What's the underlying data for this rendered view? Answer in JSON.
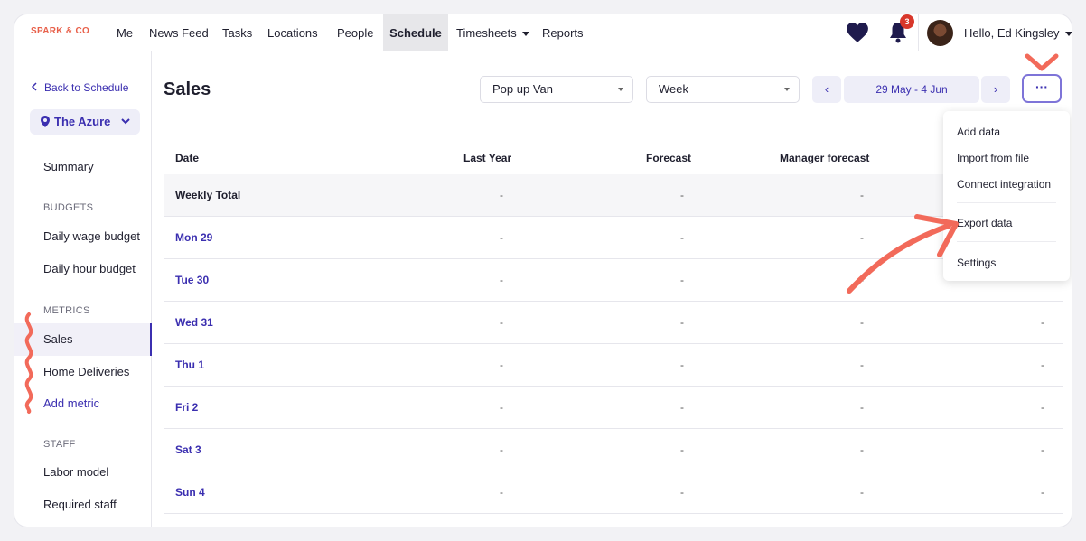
{
  "brand": "SPARK & CO",
  "nav": {
    "items": [
      "Me",
      "News Feed",
      "Tasks",
      "Locations",
      "People",
      "Schedule",
      "Timesheets",
      "Reports"
    ],
    "active": "Schedule",
    "notification_count": "3",
    "greeting": "Hello, Ed Kingsley"
  },
  "sidebar": {
    "back_label": "Back to Schedule",
    "location": "The Azure",
    "summary": "Summary",
    "budgets_heading": "BUDGETS",
    "daily_wage_budget": "Daily wage budget",
    "daily_hour_budget": "Daily hour budget",
    "metrics_heading": "METRICS",
    "sales": "Sales",
    "home_deliveries": "Home Deliveries",
    "add_metric": "Add metric",
    "staff_heading": "STAFF",
    "labor_model": "Labor model",
    "required_staff": "Required staff"
  },
  "main": {
    "title": "Sales",
    "location_select": "Pop up Van",
    "period_select": "Week",
    "prev": "‹",
    "next": "›",
    "date_range": "29 May - 4 Jun",
    "more": "···"
  },
  "table": {
    "headers": [
      "Date",
      "Last Year",
      "Forecast",
      "Manager forecast"
    ],
    "rows": [
      {
        "date": "Weekly Total",
        "cells": [
          "-",
          "-",
          "-"
        ]
      },
      {
        "date": "Mon 29",
        "cells": [
          "-",
          "-",
          "-"
        ]
      },
      {
        "date": "Tue 30",
        "cells": [
          "-",
          "-",
          "-"
        ]
      },
      {
        "date": "Wed 31",
        "cells": [
          "-",
          "-",
          "-",
          "-"
        ]
      },
      {
        "date": "Thu 1",
        "cells": [
          "-",
          "-",
          "-",
          "-"
        ]
      },
      {
        "date": "Fri 2",
        "cells": [
          "-",
          "-",
          "-",
          "-"
        ]
      },
      {
        "date": "Sat 3",
        "cells": [
          "-",
          "-",
          "-",
          "-"
        ]
      },
      {
        "date": "Sun 4",
        "cells": [
          "-",
          "-",
          "-",
          "-"
        ]
      }
    ]
  },
  "menu": {
    "add_data": "Add data",
    "import_from_file": "Import from file",
    "connect_integration": "Connect integration",
    "export_data": "Export data",
    "settings": "Settings"
  },
  "colors": {
    "brand": "#e8604a",
    "accent": "#3b2fb0",
    "annotation": "#f26a5a",
    "badge": "#d8372b"
  },
  "icons": [
    "heart-icon",
    "bell-icon",
    "chevron-left-icon",
    "map-pin-icon",
    "chevron-down-icon",
    "more-icon"
  ]
}
